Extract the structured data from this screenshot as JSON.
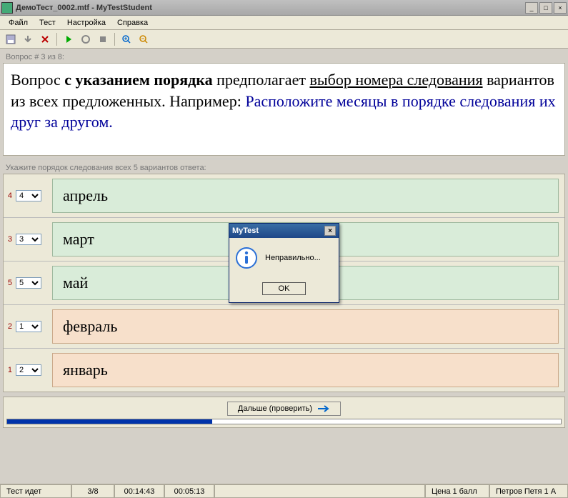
{
  "window": {
    "title": "ДемоТест_0002.mtf - MyTestStudent",
    "min_icon": "_",
    "max_icon": "□",
    "close_icon": "×"
  },
  "menu": {
    "items": [
      "Файл",
      "Тест",
      "Настройка",
      "Справка"
    ]
  },
  "question_counter": "Вопрос # 3 из 8:",
  "question": {
    "p1a": "Вопрос ",
    "p1b": "с указанием порядка",
    "p1c": " предполагает ",
    "p1d": "выбор номера следования",
    "p1e": " вариантов из всех предложенных. Например: ",
    "p2": "Расположите месяцы в порядке следования их друг за другом."
  },
  "instruction": "Укажите порядок следования всех 5 вариантов ответа:",
  "answers": [
    {
      "num": "4",
      "sel": "4",
      "text": "апрель",
      "cls": "green"
    },
    {
      "num": "3",
      "sel": "3",
      "text": "март",
      "cls": "green"
    },
    {
      "num": "5",
      "sel": "5",
      "text": "май",
      "cls": "green"
    },
    {
      "num": "2",
      "sel": "1",
      "text": "февраль",
      "cls": "peach"
    },
    {
      "num": "1",
      "sel": "2",
      "text": "январь",
      "cls": "peach"
    }
  ],
  "next_button": "Дальше (проверить)",
  "status": {
    "state": "Тест идет",
    "progress": "3/8",
    "t1": "00:14:43",
    "t2": "00:05:13",
    "price": "Цена 1 балл",
    "user": "Петров Петя 1 А"
  },
  "dialog": {
    "title": "MyTest",
    "message": "Неправильно...",
    "ok": "OK",
    "close": "×"
  }
}
